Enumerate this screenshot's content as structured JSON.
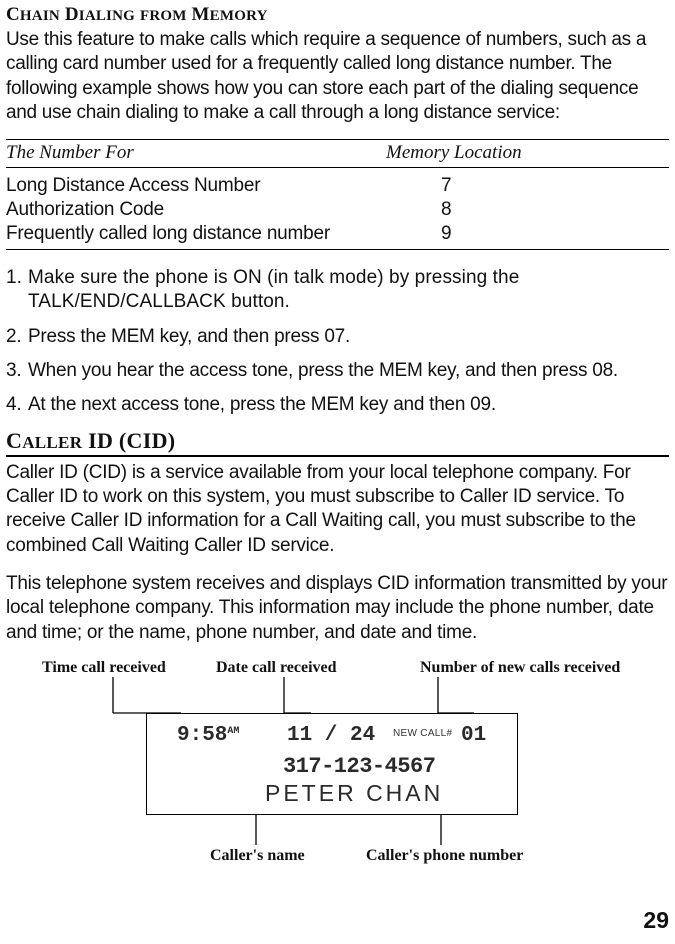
{
  "section1": {
    "heading_main": "C",
    "heading_sc1": "HAIN",
    "heading_sp": " D",
    "heading_sc2": "IALING",
    "heading_sp2": " ",
    "heading_sc3": "FROM",
    "heading_sp3": " M",
    "heading_sc4": "EMORY",
    "intro": "Use this feature to make calls which require a sequence of numbers, such as a calling card number used for a frequently called long distance number. The following example shows how you can store each part of the dialing sequence and use chain dialing to make a call through a long distance service:"
  },
  "table": {
    "head_col1": "The Number  For",
    "head_col2": "Memory Location",
    "rows": [
      {
        "c1": "Long Distance Access Number",
        "c2": "7"
      },
      {
        "c1": "Authorization Code",
        "c2": "8"
      },
      {
        "c1": "Frequently called long distance number",
        "c2": "9"
      }
    ]
  },
  "steps": [
    {
      "n": "1.",
      "t": "Make sure the phone is ON (in talk mode) by pressing the TALK/END/CALLBACK button."
    },
    {
      "n": "2.",
      "t": "Press the MEM key, and then press 07."
    },
    {
      "n": "3.",
      "t": "When you hear the access tone, press the MEM key, and then press 08."
    },
    {
      "n": "4.",
      "t": "At the next access tone, press the MEM key and then 09."
    }
  ],
  "section2": {
    "heading_main": "C",
    "heading_sc1": "ALLER",
    "heading_sp": " ID (CID)",
    "para1": "Caller ID (CID) is a service available from your local telephone company. For Caller ID to work on this system, you must subscribe to Caller ID service. To receive Caller ID information for a Call Waiting call, you must subscribe to the combined Call Waiting Caller ID service.",
    "para2": "This telephone system receives and displays CID information transmitted by your local telephone company. This information may include the phone number, date and time; or the name, phone number, and date and time."
  },
  "diagram": {
    "label_time": "Time call received",
    "label_date": "Date call received",
    "label_newcalls": "Number of new calls received",
    "label_name": "Caller's name",
    "label_phone": "Caller's phone number",
    "lcd_time": "9:58",
    "lcd_ampm": "AM",
    "lcd_date": "11 / 24",
    "lcd_newcall_label": "NEW CALL#",
    "lcd_newcall_num": "01",
    "lcd_phone": "317-123-4567",
    "lcd_name": "PETER CHAN"
  },
  "page_number": "29"
}
